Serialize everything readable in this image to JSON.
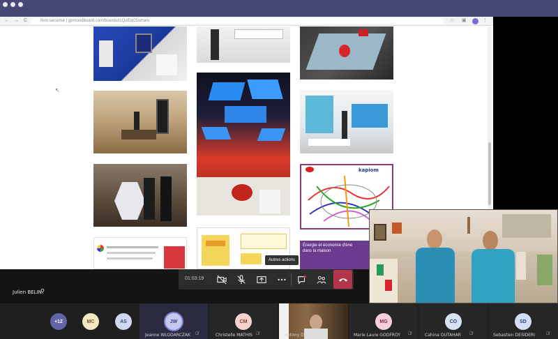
{
  "browser": {
    "url": "Non sécurisé  |  gomoodboard.com/boards/t1QoEqC5/share",
    "nav": {
      "back": "←",
      "forward": "→",
      "reload": "C"
    }
  },
  "board": {
    "map_brand": "kapiom",
    "energy_line1": "Énergie et économie d'éne",
    "energy_line2": "dans la maison"
  },
  "call": {
    "speaker_name": "Julien BELIN",
    "timer": "01:03:19",
    "tooltip": "Autres actions"
  },
  "participants": [
    {
      "initials": "+12",
      "color": "#6264a7",
      "name": ""
    },
    {
      "initials": "MC",
      "color": "#f3e6c1",
      "name": ""
    },
    {
      "initials": "AS",
      "color": "#cfd8f0",
      "name": ""
    },
    {
      "initials": "JW",
      "color": "#c5c9f0",
      "name": "Jeanne WLODARCZAK"
    },
    {
      "initials": "CM",
      "color": "#f5d3cc",
      "name": "Christelle MATHIS"
    },
    {
      "initials": "",
      "color": "",
      "name": "Antony DAUZET"
    },
    {
      "initials": "MG",
      "color": "#f5d0da",
      "name": "Marie Laure GODFROY"
    },
    {
      "initials": "CO",
      "color": "#d9e2f5",
      "name": "Cahina OUTAHAR"
    },
    {
      "initials": "SD",
      "color": "#d2def5",
      "name": "Sebastien DESIDERI"
    }
  ],
  "colors": {
    "titlebar": "#464775",
    "hangup": "#b3354a",
    "map_border": "#8c3a7c",
    "energy": "#6c3a8e"
  }
}
